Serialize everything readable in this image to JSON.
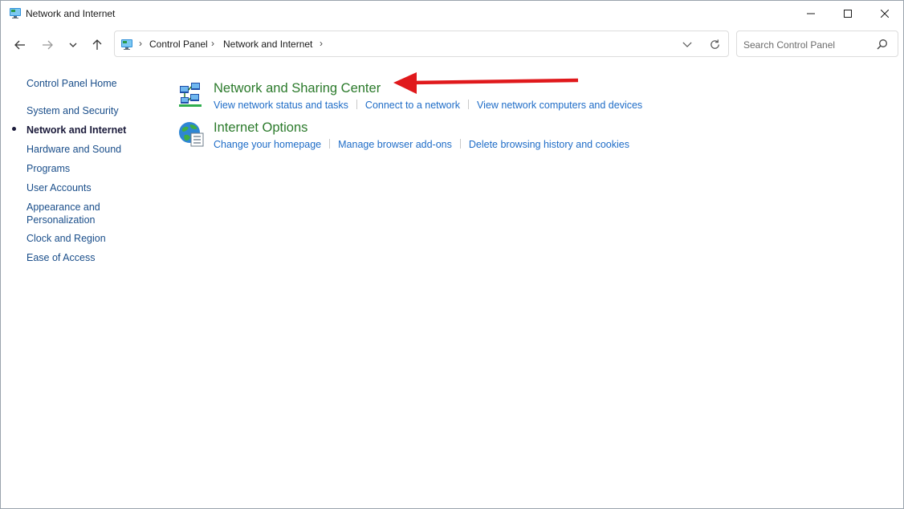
{
  "window": {
    "title": "Network and Internet"
  },
  "address_bar": {
    "breadcrumbs": [
      "Control Panel",
      "Network and Internet"
    ],
    "separator": "›"
  },
  "search": {
    "placeholder": "Search Control Panel"
  },
  "sidebar": {
    "items": [
      {
        "label": "Control Panel Home",
        "current": false
      },
      {
        "label": "System and Security",
        "current": false
      },
      {
        "label": "Network and Internet",
        "current": true
      },
      {
        "label": "Hardware and Sound",
        "current": false
      },
      {
        "label": "Programs",
        "current": false
      },
      {
        "label": "User Accounts",
        "current": false
      },
      {
        "label": "Appearance and Personalization",
        "current": false
      },
      {
        "label": "Clock and Region",
        "current": false
      },
      {
        "label": "Ease of Access",
        "current": false
      }
    ]
  },
  "categories": [
    {
      "title": "Network and Sharing Center",
      "icon": "network-sharing-icon",
      "links": [
        "View network status and tasks",
        "Connect to a network",
        "View network computers and devices"
      ]
    },
    {
      "title": "Internet Options",
      "icon": "internet-options-icon",
      "links": [
        "Change your homepage",
        "Manage browser add-ons",
        "Delete browsing history and cookies"
      ]
    }
  ],
  "colors": {
    "category_title": "#2b7a2b",
    "link": "#1e6cc7",
    "annotation_arrow": "#e0191c"
  }
}
